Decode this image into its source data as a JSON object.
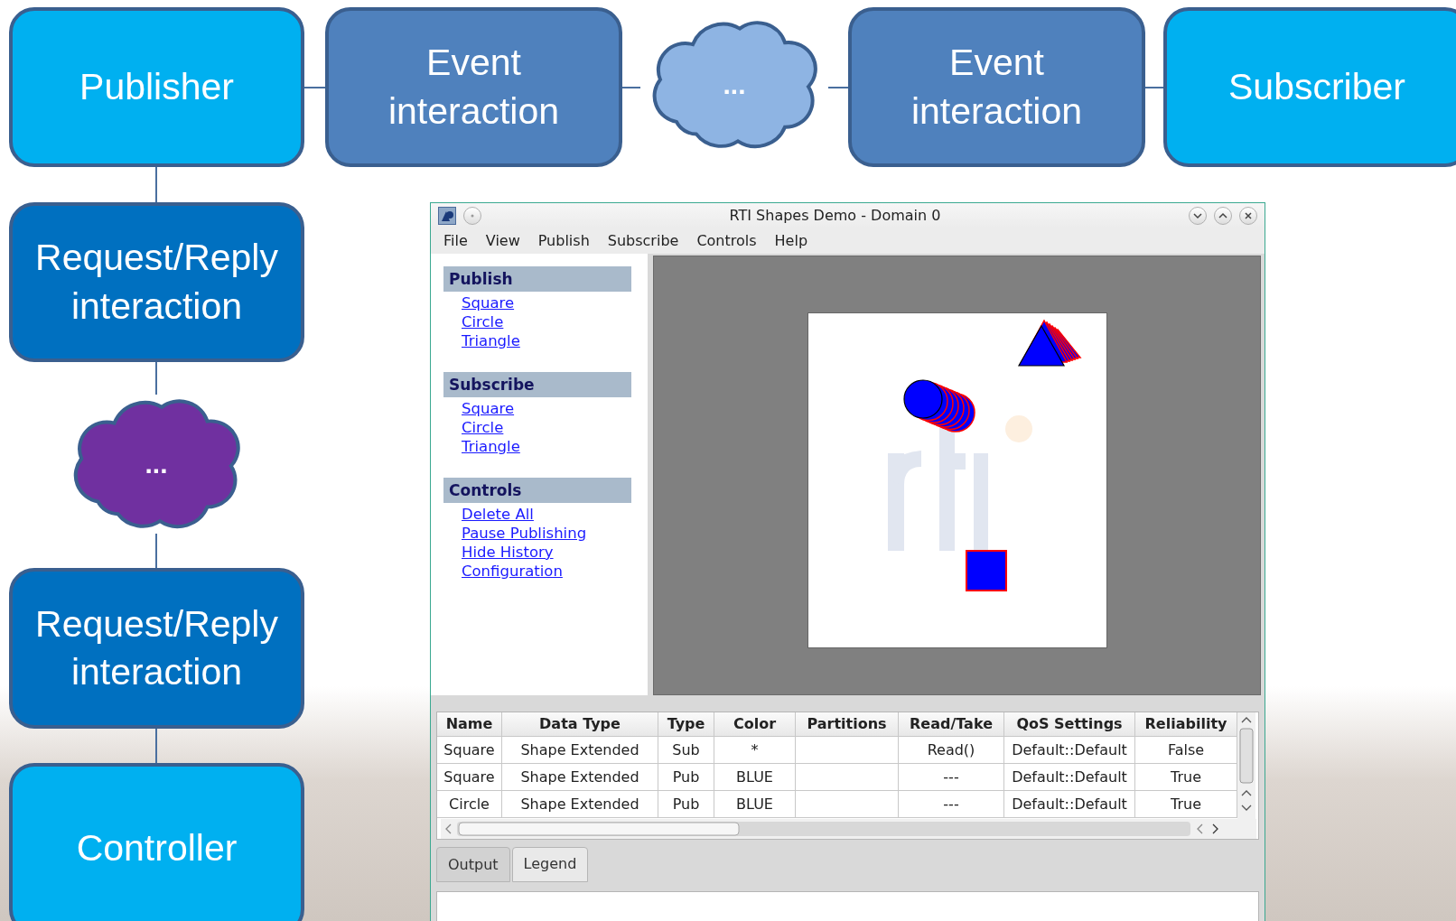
{
  "diagram": {
    "top_row": [
      {
        "kind": "box",
        "label": "Publisher",
        "color": "#00b0f0"
      },
      {
        "kind": "box",
        "label": "Event interaction",
        "color": "#4f81bd"
      },
      {
        "kind": "cloud",
        "label": "...",
        "color": "#8eb4e3"
      },
      {
        "kind": "box",
        "label": "Event interaction",
        "color": "#4f81bd"
      },
      {
        "kind": "box",
        "label": "Subscriber",
        "color": "#00b0f0"
      }
    ],
    "left_column": [
      {
        "kind": "box",
        "label": "Request/Reply interaction",
        "color": "#0070c0"
      },
      {
        "kind": "cloud",
        "label": "...",
        "color": "#7030a0"
      },
      {
        "kind": "box",
        "label": "Request/Reply interaction",
        "color": "#0070c0"
      },
      {
        "kind": "box",
        "label": "Controller",
        "color": "#00b0f0"
      }
    ]
  },
  "window": {
    "title": "RTI Shapes Demo - Domain 0",
    "menu": [
      "File",
      "View",
      "Publish",
      "Subscribe",
      "Controls",
      "Help"
    ],
    "sidebar": [
      {
        "heading": "Publish",
        "links": [
          "Square",
          "Circle",
          "Triangle"
        ]
      },
      {
        "heading": "Subscribe",
        "links": [
          "Square",
          "Circle",
          "Triangle"
        ]
      },
      {
        "heading": "Controls",
        "links": [
          "Delete All",
          "Pause Publishing",
          "Hide History",
          "Configuration"
        ]
      }
    ],
    "canvas_shapes": [
      {
        "kind": "triangle"
      },
      {
        "kind": "circle"
      },
      {
        "kind": "square"
      }
    ],
    "table": {
      "columns": [
        "Name",
        "Data Type",
        "Type",
        "Color",
        "Partitions",
        "Read/Take",
        "QoS Settings",
        "Reliability"
      ],
      "rows": [
        [
          "Square",
          "Shape Extended",
          "Sub",
          "*",
          "",
          "Read()",
          "Default::Default",
          "False"
        ],
        [
          "Square",
          "Shape Extended",
          "Pub",
          "BLUE",
          "",
          "---",
          "Default::Default",
          "True"
        ],
        [
          "Circle",
          "Shape Extended",
          "Pub",
          "BLUE",
          "",
          "---",
          "Default::Default",
          "True"
        ]
      ]
    },
    "tabs": [
      {
        "label": "Output",
        "selected": false
      },
      {
        "label": "Legend",
        "selected": true
      }
    ]
  }
}
